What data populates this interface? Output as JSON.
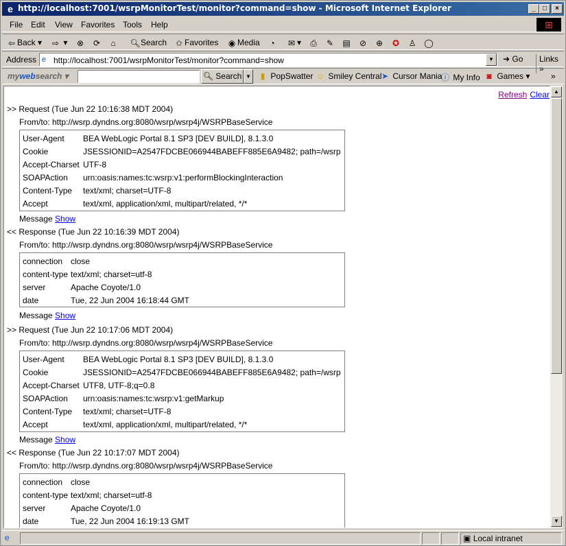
{
  "window": {
    "title": "http://localhost:7001/wsrpMonitorTest/monitor?command=show - Microsoft Internet Explorer"
  },
  "menu": [
    "File",
    "Edit",
    "View",
    "Favorites",
    "Tools",
    "Help"
  ],
  "toolbar": {
    "back": "Back",
    "search": "Search",
    "favorites": "Favorites",
    "media": "Media"
  },
  "address": {
    "label": "Address",
    "url": "http://localhost:7001/wsrpMonitorTest/monitor?command=show",
    "go": "Go",
    "links": "Links"
  },
  "searchbar": {
    "brand_prefix": "my",
    "brand_main": "web",
    "brand_suffix": "search",
    "input_value": "",
    "button": "Search",
    "links": [
      "PopSwatter",
      "Smiley Central",
      "Cursor Mania",
      "My Info",
      "Games"
    ]
  },
  "page": {
    "refresh": "Refresh",
    "clear": "Clear",
    "message_label": "Message",
    "show_label": "Show",
    "entries": [
      {
        "heading": ">> Request (Tue Jun 22 10:16:38 MDT 2004)",
        "from": "From/to: http://wsrp.dyndns.org:8080/wsrp/wsrp4j/WSRPBaseService",
        "headers": [
          {
            "k": "User-Agent",
            "v": "BEA WebLogic Portal 8.1 SP3 [DEV BUILD], 8.1.3.0"
          },
          {
            "k": "Cookie",
            "v": "JSESSIONID=A2547FDCBE066944BABEFF885E6A9482; path=/wsrp"
          },
          {
            "k": "Accept-Charset",
            "v": "UTF-8"
          },
          {
            "k": "SOAPAction",
            "v": "urn:oasis:names:tc:wsrp:v1:performBlockingInteraction"
          },
          {
            "k": "Content-Type",
            "v": "text/xml; charset=UTF-8"
          },
          {
            "k": "Accept",
            "v": "text/xml, application/xml, multipart/related, */*"
          }
        ]
      },
      {
        "heading": "<< Response (Tue Jun 22 10:16:39 MDT 2004)",
        "from": "From/to: http://wsrp.dyndns.org:8080/wsrp/wsrp4j/WSRPBaseService",
        "headers": [
          {
            "k": "connection",
            "v": "close"
          },
          {
            "k": "content-type",
            "v": "text/xml; charset=utf-8"
          },
          {
            "k": "server",
            "v": "Apache Coyote/1.0"
          },
          {
            "k": "date",
            "v": "Tue, 22 Jun 2004 16:18:44 GMT"
          }
        ]
      },
      {
        "heading": ">> Request (Tue Jun 22 10:17:06 MDT 2004)",
        "from": "From/to: http://wsrp.dyndns.org:8080/wsrp/wsrp4j/WSRPBaseService",
        "headers": [
          {
            "k": "User-Agent",
            "v": "BEA WebLogic Portal 8.1 SP3 [DEV BUILD], 8.1.3.0"
          },
          {
            "k": "Cookie",
            "v": "JSESSIONID=A2547FDCBE066944BABEFF885E6A9482; path=/wsrp"
          },
          {
            "k": "Accept-Charset",
            "v": "UTF8, UTF-8;q=0.8"
          },
          {
            "k": "SOAPAction",
            "v": "urn:oasis:names:tc:wsrp:v1:getMarkup"
          },
          {
            "k": "Content-Type",
            "v": "text/xml; charset=UTF-8"
          },
          {
            "k": "Accept",
            "v": "text/xml, application/xml, multipart/related, */*"
          }
        ]
      },
      {
        "heading": "<< Response (Tue Jun 22 10:17:07 MDT 2004)",
        "from": "From/to: http://wsrp.dyndns.org:8080/wsrp/wsrp4j/WSRPBaseService",
        "headers": [
          {
            "k": "connection",
            "v": "close"
          },
          {
            "k": "content-type",
            "v": "text/xml; charset=utf-8"
          },
          {
            "k": "server",
            "v": "Apache Coyote/1.0"
          },
          {
            "k": "date",
            "v": "Tue, 22 Jun 2004 16:19:13 GMT"
          }
        ]
      }
    ]
  },
  "status": {
    "zone": "Local intranet"
  }
}
